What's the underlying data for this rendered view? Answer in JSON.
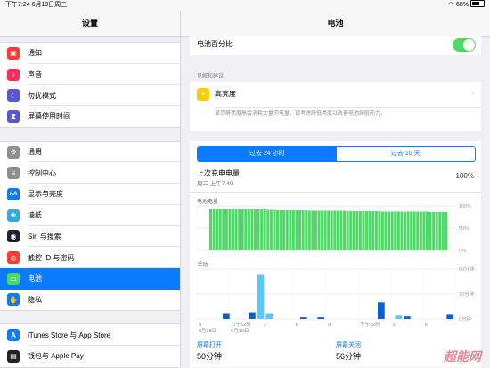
{
  "status": {
    "time_date": "下午7:24 6月19日周三",
    "battery": "68%"
  },
  "sidebar": {
    "title": "设置",
    "groups": [
      [
        {
          "label": "通知",
          "icon": "notification-icon",
          "color": "#ff3b30",
          "glyph": "▣"
        },
        {
          "label": "声音",
          "icon": "speaker-icon",
          "color": "#ff2d55",
          "glyph": "♪"
        },
        {
          "label": "勿扰模式",
          "icon": "moon-icon",
          "color": "#5856d6",
          "glyph": "☾"
        },
        {
          "label": "屏幕使用时间",
          "icon": "hourglass-icon",
          "color": "#5856d6",
          "glyph": "⧗"
        }
      ],
      [
        {
          "label": "通用",
          "icon": "gear-icon",
          "color": "#8e8e93",
          "glyph": "⚙"
        },
        {
          "label": "控制中心",
          "icon": "switches-icon",
          "color": "#8e8e93",
          "glyph": "≡"
        },
        {
          "label": "显示与亮度",
          "icon": "display-icon",
          "color": "#0a7aff",
          "glyph": "AA"
        },
        {
          "label": "墙纸",
          "icon": "flower-icon",
          "color": "#34aadc",
          "glyph": "❀"
        },
        {
          "label": "Siri 与搜索",
          "icon": "siri-icon",
          "color": "#222233",
          "glyph": "◉"
        },
        {
          "label": "触控 ID 与密码",
          "icon": "fingerprint-icon",
          "color": "#ff3b30",
          "glyph": "◎"
        },
        {
          "label": "电池",
          "icon": "battery-icon",
          "color": "#4cd964",
          "glyph": "▭",
          "active": true
        },
        {
          "label": "隐私",
          "icon": "hand-icon",
          "color": "#0a7aff",
          "glyph": "✋"
        }
      ],
      [
        {
          "label": "iTunes Store 与 App Store",
          "icon": "appstore-icon",
          "color": "#0a7aff",
          "glyph": "A"
        },
        {
          "label": "钱包与 Apple Pay",
          "icon": "wallet-icon",
          "color": "#222222",
          "glyph": "▤"
        }
      ]
    ]
  },
  "main": {
    "title": "电池",
    "battery_percentage_label": "电池百分比",
    "battery_percentage_on": true,
    "insights_label": "见解和建议",
    "advice": {
      "title": "高亮度",
      "desc": "显示屏亮度高会消耗大量的电量。请考虑降低亮度以改善电池续航能力。"
    },
    "segments": {
      "active": "过去 24 小时",
      "inactive": "过去 10 天"
    },
    "last_charge": {
      "title": "上次充电电量",
      "time": "周二 上午7:49",
      "level": "100%"
    },
    "level_chart_label": "电池电量",
    "activity_chart_label": "活动",
    "screen_on": {
      "label": "屏幕打开",
      "value": "50分钟"
    },
    "screen_off": {
      "label": "屏幕关闭",
      "value": "56分钟"
    },
    "watermark": "超能网"
  },
  "chart_data": [
    {
      "type": "bar",
      "title": "电池电量",
      "y_ticks": [
        "100%",
        "50%",
        "0%"
      ],
      "ylim": [
        0,
        100
      ],
      "values": [
        93,
        93,
        93,
        93,
        93,
        93,
        93,
        93,
        93,
        93,
        93,
        93,
        93,
        92,
        92,
        92,
        92,
        92,
        91,
        91,
        91,
        90,
        90,
        90,
        90,
        90,
        90,
        90,
        90,
        90,
        90,
        89,
        89,
        89,
        89,
        89,
        89,
        89,
        89,
        89,
        89,
        89,
        89,
        88,
        88,
        88,
        88,
        88,
        88,
        88,
        88,
        88,
        88,
        88,
        87,
        87,
        87,
        87,
        87,
        87,
        87,
        87,
        87,
        87,
        87,
        87,
        87,
        87,
        87,
        86,
        86,
        86,
        86,
        86,
        86
      ],
      "color": "#4cd964"
    },
    {
      "type": "bar",
      "title": "活动",
      "y_ticks": [
        "60分钟",
        "30分钟",
        "0分钟"
      ],
      "ylim": [
        0,
        60
      ],
      "x_ticks": [
        "9",
        "上午12时",
        "3",
        "6",
        "9",
        "下午12时",
        "3",
        "6"
      ],
      "x_sub": [
        "6月18日",
        "6月19日"
      ],
      "series": [
        {
          "name": "屏幕打开",
          "color": "#0a60d0",
          "bars": [
            [
              6,
              7
            ],
            [
              12,
              8
            ],
            [
              24,
              2
            ],
            [
              28,
              2
            ],
            [
              42,
              20
            ],
            [
              48,
              3
            ],
            [
              58,
              6
            ]
          ]
        },
        {
          "name": "屏幕关闭",
          "color": "#5ac8fa",
          "bars": [
            [
              14,
              53
            ],
            [
              16,
              7
            ],
            [
              46,
              4
            ]
          ]
        }
      ],
      "slots": 60
    }
  ]
}
